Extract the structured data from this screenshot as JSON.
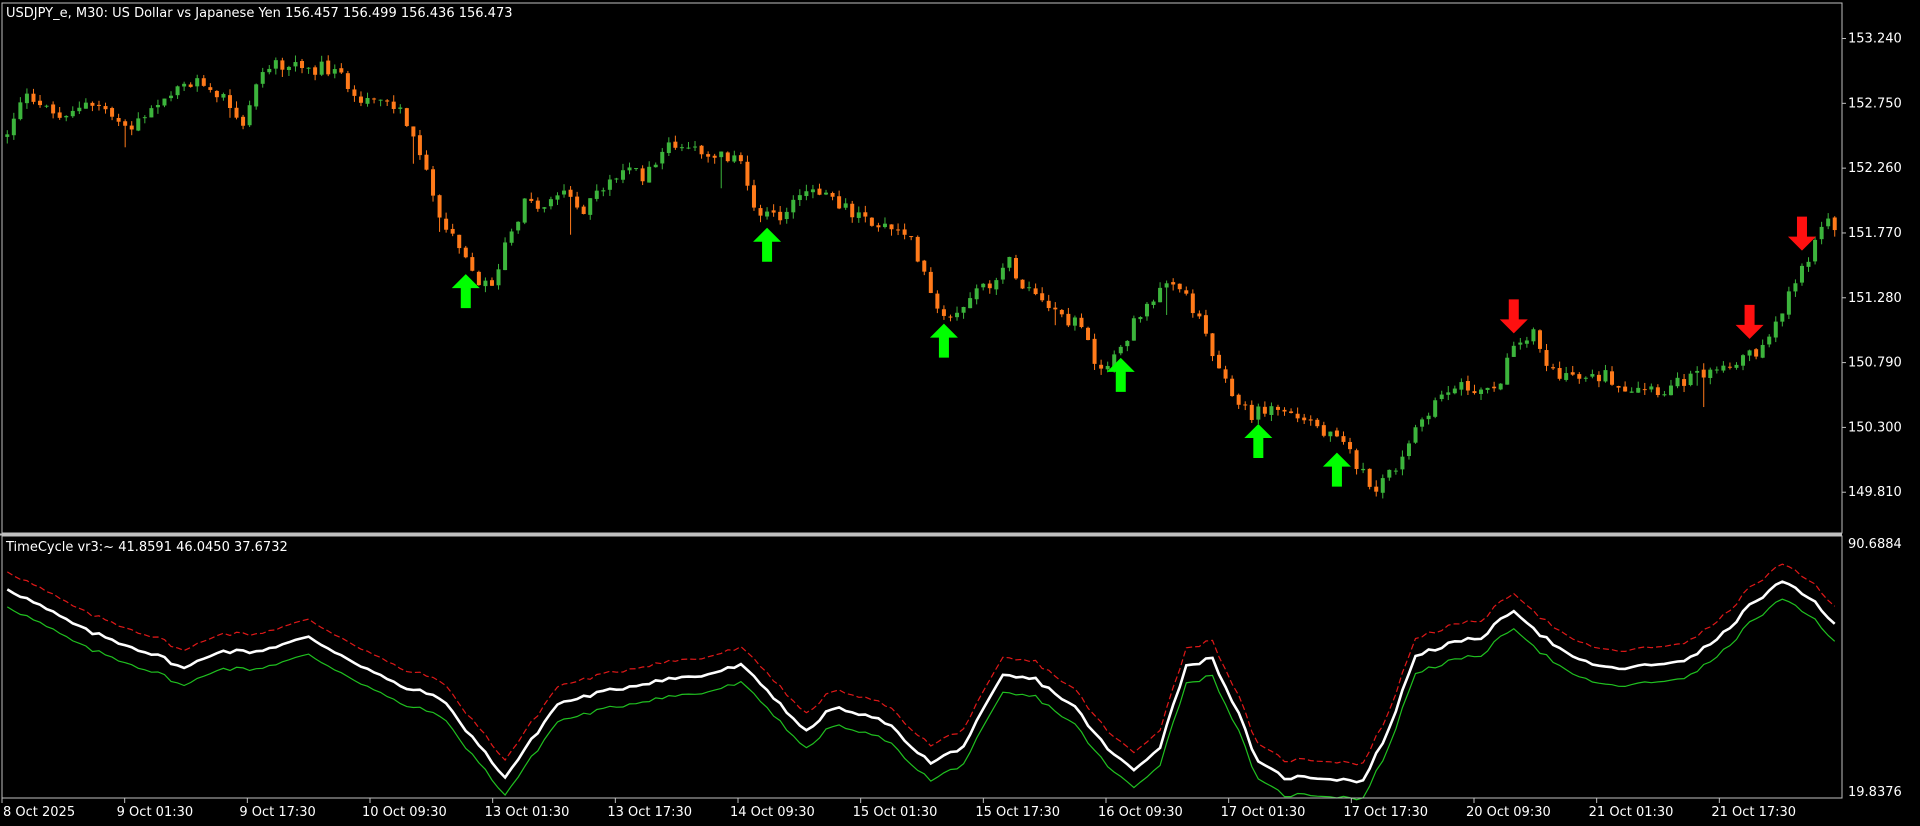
{
  "main_header": {
    "symbol": "USDJPY_e,",
    "timeframe": "M30:",
    "description": "US Dollar vs Japanese Yen",
    "ohlc": "156.457 156.499 156.436 156.473"
  },
  "indicator_header": {
    "name": "TimeCycle vr3:~",
    "values": "41.8591 46.0450 37.6732"
  },
  "colors": {
    "background": "#000000",
    "frame": "#c0c0c0",
    "bull": "#3cb43c",
    "bear": "#ff7a1a",
    "arrow_up": "#00ff00",
    "arrow_down": "#ff1010",
    "cycle_main": "#ffffff",
    "cycle_upper": "#e01818",
    "cycle_lower": "#20c020"
  },
  "chart_data": [
    {
      "type": "candlestick",
      "title": "USDJPY_e, M30",
      "y_axis_ticks": [
        "153.240",
        "152.750",
        "152.260",
        "151.770",
        "151.280",
        "150.790",
        "150.300",
        "149.810"
      ],
      "ylim": [
        149.6,
        153.38
      ],
      "x_axis_ticks": [
        "8 Oct 2025",
        "9 Oct 01:30",
        "9 Oct 17:30",
        "10 Oct 09:30",
        "13 Oct 01:30",
        "13 Oct 17:30",
        "14 Oct 09:30",
        "15 Oct 01:30",
        "15 Oct 17:30",
        "16 Oct 09:30",
        "17 Oct 01:30",
        "17 Oct 17:30",
        "20 Oct 09:30",
        "21 Oct 01:30",
        "21 Oct 17:30"
      ],
      "candle_count": 280,
      "close_path": [
        [
          0,
          152.5
        ],
        [
          3,
          152.85
        ],
        [
          6,
          152.7
        ],
        [
          9,
          152.62
        ],
        [
          12,
          152.78
        ],
        [
          15,
          152.7
        ],
        [
          18,
          152.55
        ],
        [
          21,
          152.65
        ],
        [
          24,
          152.75
        ],
        [
          27,
          152.88
        ],
        [
          30,
          152.9
        ],
        [
          33,
          152.8
        ],
        [
          36,
          152.6
        ],
        [
          39,
          153.0
        ],
        [
          42,
          153.05
        ],
        [
          45,
          153.0
        ],
        [
          48,
          153.02
        ],
        [
          51,
          152.95
        ],
        [
          54,
          152.8
        ],
        [
          57,
          152.75
        ],
        [
          60,
          152.7
        ],
        [
          62,
          152.5
        ],
        [
          64,
          152.2
        ],
        [
          67,
          151.8
        ],
        [
          70,
          151.55
        ],
        [
          72,
          151.4
        ],
        [
          74,
          151.35
        ],
        [
          76,
          151.7
        ],
        [
          79,
          152.0
        ],
        [
          82,
          151.95
        ],
        [
          85,
          152.1
        ],
        [
          88,
          151.95
        ],
        [
          91,
          152.1
        ],
        [
          94,
          152.25
        ],
        [
          97,
          152.2
        ],
        [
          100,
          152.4
        ],
        [
          103,
          152.45
        ],
        [
          106,
          152.4
        ],
        [
          109,
          152.35
        ],
        [
          112,
          152.3
        ],
        [
          114,
          152.0
        ],
        [
          116,
          151.9
        ],
        [
          118,
          151.85
        ],
        [
          120,
          152.05
        ],
        [
          123,
          152.1
        ],
        [
          126,
          152.05
        ],
        [
          129,
          151.9
        ],
        [
          132,
          151.85
        ],
        [
          135,
          151.8
        ],
        [
          138,
          151.7
        ],
        [
          140,
          151.5
        ],
        [
          142,
          151.2
        ],
        [
          144,
          151.15
        ],
        [
          147,
          151.3
        ],
        [
          150,
          151.4
        ],
        [
          153,
          151.55
        ],
        [
          155,
          151.4
        ],
        [
          158,
          151.3
        ],
        [
          161,
          151.15
        ],
        [
          164,
          151.05
        ],
        [
          166,
          150.8
        ],
        [
          168,
          150.75
        ],
        [
          171,
          151.0
        ],
        [
          174,
          151.25
        ],
        [
          177,
          151.35
        ],
        [
          180,
          151.3
        ],
        [
          183,
          151.0
        ],
        [
          185,
          150.7
        ],
        [
          187,
          150.55
        ],
        [
          190,
          150.4
        ],
        [
          193,
          150.45
        ],
        [
          196,
          150.4
        ],
        [
          199,
          150.35
        ],
        [
          201,
          150.25
        ],
        [
          203,
          150.2
        ],
        [
          205,
          150.1
        ],
        [
          207,
          149.95
        ],
        [
          209,
          149.85
        ],
        [
          212,
          150.0
        ],
        [
          215,
          150.3
        ],
        [
          218,
          150.5
        ],
        [
          221,
          150.6
        ],
        [
          224,
          150.6
        ],
        [
          227,
          150.55
        ],
        [
          229,
          150.8
        ],
        [
          231,
          150.95
        ],
        [
          233,
          151.0
        ],
        [
          235,
          150.75
        ],
        [
          238,
          150.7
        ],
        [
          241,
          150.65
        ],
        [
          244,
          150.7
        ],
        [
          247,
          150.6
        ],
        [
          250,
          150.62
        ],
        [
          253,
          150.58
        ],
        [
          256,
          150.65
        ],
        [
          259,
          150.7
        ],
        [
          262,
          150.75
        ],
        [
          265,
          150.8
        ],
        [
          268,
          150.9
        ],
        [
          270,
          151.05
        ],
        [
          272,
          151.3
        ],
        [
          274,
          151.5
        ],
        [
          276,
          151.7
        ],
        [
          278,
          151.85
        ],
        [
          279,
          151.82
        ]
      ],
      "signals": [
        {
          "type": "buy",
          "candle": 70
        },
        {
          "type": "buy",
          "candle": 116
        },
        {
          "type": "buy",
          "candle": 143
        },
        {
          "type": "buy",
          "candle": 170
        },
        {
          "type": "buy",
          "candle": 191
        },
        {
          "type": "buy",
          "candle": 203
        },
        {
          "type": "sell",
          "candle": 230
        },
        {
          "type": "sell",
          "candle": 266
        },
        {
          "type": "sell",
          "candle": 274
        }
      ]
    },
    {
      "type": "line",
      "title": "TimeCycle vr3",
      "y_axis_ticks": [
        "90.6884",
        "19.8376"
      ],
      "ylim": [
        19.8376,
        90.6884
      ],
      "series": [
        {
          "name": "main",
          "points": [
            [
              0,
              78
            ],
            [
              12,
              66
            ],
            [
              24,
              58
            ],
            [
              27,
              55
            ],
            [
              32,
              60
            ],
            [
              38,
              60
            ],
            [
              46,
              64
            ],
            [
              52,
              58
            ],
            [
              60,
              50
            ],
            [
              66,
              47
            ],
            [
              76,
              24
            ],
            [
              84,
              45
            ],
            [
              90,
              48
            ],
            [
              100,
              52
            ],
            [
              106,
              53
            ],
            [
              112,
              56
            ],
            [
              116,
              49
            ],
            [
              122,
              37
            ],
            [
              126,
              44
            ],
            [
              134,
              40
            ],
            [
              141,
              28
            ],
            [
              146,
              33
            ],
            [
              152,
              53
            ],
            [
              157,
              52
            ],
            [
              163,
              44
            ],
            [
              168,
              32
            ],
            [
              172,
              26
            ],
            [
              176,
              33
            ],
            [
              180,
              56
            ],
            [
              184,
              58
            ],
            [
              188,
              42
            ],
            [
              191,
              28
            ],
            [
              195,
              24
            ],
            [
              200,
              24
            ],
            [
              207,
              23
            ],
            [
              211,
              38
            ],
            [
              215,
              59
            ],
            [
              220,
              62
            ],
            [
              225,
              64
            ],
            [
              230,
              72
            ],
            [
              234,
              65
            ],
            [
              239,
              58
            ],
            [
              245,
              55
            ],
            [
              251,
              56
            ],
            [
              257,
              58
            ],
            [
              262,
              65
            ],
            [
              266,
              73
            ],
            [
              271,
              80
            ],
            [
              276,
              74
            ],
            [
              279,
              68
            ]
          ]
        },
        {
          "name": "upper",
          "offset": 5
        },
        {
          "name": "lower",
          "offset": -5
        }
      ]
    }
  ]
}
